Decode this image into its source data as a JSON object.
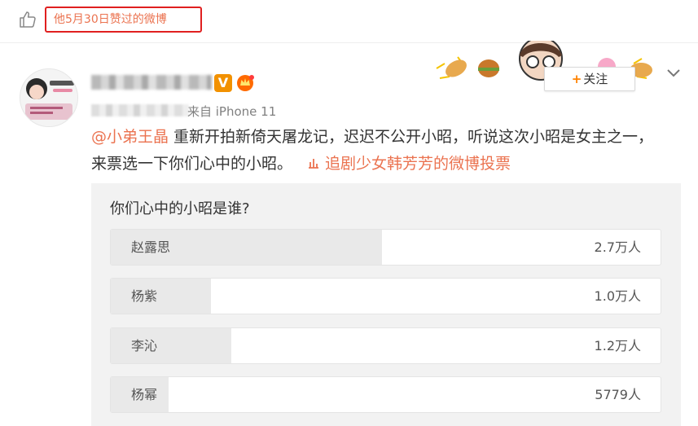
{
  "like_banner": {
    "text": "他5月30日赞过的微博"
  },
  "post": {
    "source": "来自 iPhone 11",
    "follow_label": "关注",
    "follow_plus": "+",
    "vip_badge": "V",
    "mention": "@小弟王晶",
    "body": " 重新开拍新倚天屠龙记，迟迟不公开小昭，听说这次小昭是女主之一，来票选一下你们心中的小昭。",
    "vote_link": "追剧少女韩芳芳的微博投票"
  },
  "poll": {
    "question": "你们心中的小昭是谁?",
    "options": [
      {
        "label": "赵露思",
        "count": "2.7万人",
        "votes": 27000
      },
      {
        "label": "杨紫",
        "count": "1.0万人",
        "votes": 10000
      },
      {
        "label": "李沁",
        "count": "1.2万人",
        "votes": 12000
      },
      {
        "label": "杨幂",
        "count": "5779人",
        "votes": 5779
      }
    ]
  },
  "colors": {
    "accent": "#eb7350",
    "banner_border": "#e02020",
    "follow_plus": "#ff8200",
    "vip": "#f29100"
  },
  "icons": [
    "thumbs-up-icon",
    "vip-v-icon",
    "crown-badge-icon",
    "chevron-down-icon",
    "vote-icon"
  ]
}
